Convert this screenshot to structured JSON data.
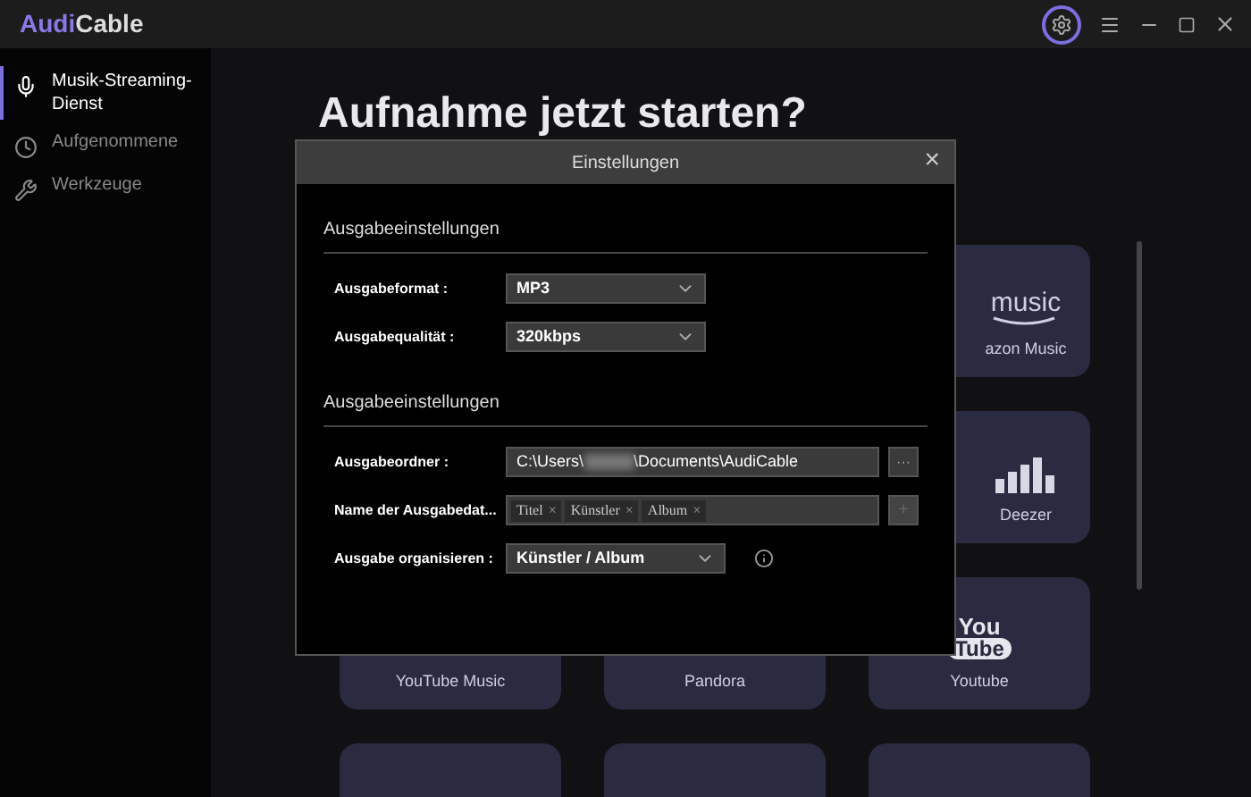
{
  "app": {
    "logo_accent": "Audi",
    "logo_rest": "Cable"
  },
  "title_bar": {
    "settings_highlighted": true
  },
  "sidebar": {
    "items": [
      {
        "label": "Musik-Streaming-Dienst",
        "selected": true
      },
      {
        "label": "Aufgenommene",
        "selected": false
      },
      {
        "label": "Werkzeuge",
        "selected": false
      }
    ]
  },
  "main": {
    "heading": "Aufnahme jetzt starten?",
    "cards": [
      {
        "kind": "amazon",
        "label": "azon Music",
        "logo_text": "music"
      },
      {
        "kind": "deezer",
        "label": "Deezer"
      },
      {
        "kind": "plain",
        "label": "YouTube Music"
      },
      {
        "kind": "plain",
        "label": "Pandora"
      },
      {
        "kind": "youtube",
        "label": "Youtube",
        "logo_text": "You",
        "logo_text_2": "Tube"
      },
      {
        "kind": "plain"
      },
      {
        "kind": "plain"
      },
      {
        "kind": "plain"
      }
    ]
  },
  "dialog": {
    "title": "Einstellungen",
    "close": "×",
    "sections": [
      {
        "title": "Ausgabeeinstellungen",
        "rows": [
          {
            "kind": "select",
            "label": "Ausgabeformat :",
            "value": "MP3"
          },
          {
            "kind": "select",
            "label": "Ausgabequalität :",
            "value": "320kbps"
          }
        ]
      },
      {
        "title": "Ausgabeeinstellungen",
        "rows": [
          {
            "kind": "path",
            "label": "Ausgabeordner :",
            "value_before": "C:\\Users\\",
            "value_after": "\\Documents\\AudiCable",
            "button": "···"
          },
          {
            "kind": "tags",
            "label": "Name der Ausgabedat...",
            "tags": [
              "Titel",
              "Künstler",
              "Album"
            ],
            "remove": "×",
            "button": "+",
            "button_disabled": true
          },
          {
            "kind": "select_info",
            "label": "Ausgabe organisieren :",
            "value": "Künstler / Album"
          }
        ]
      }
    ]
  }
}
